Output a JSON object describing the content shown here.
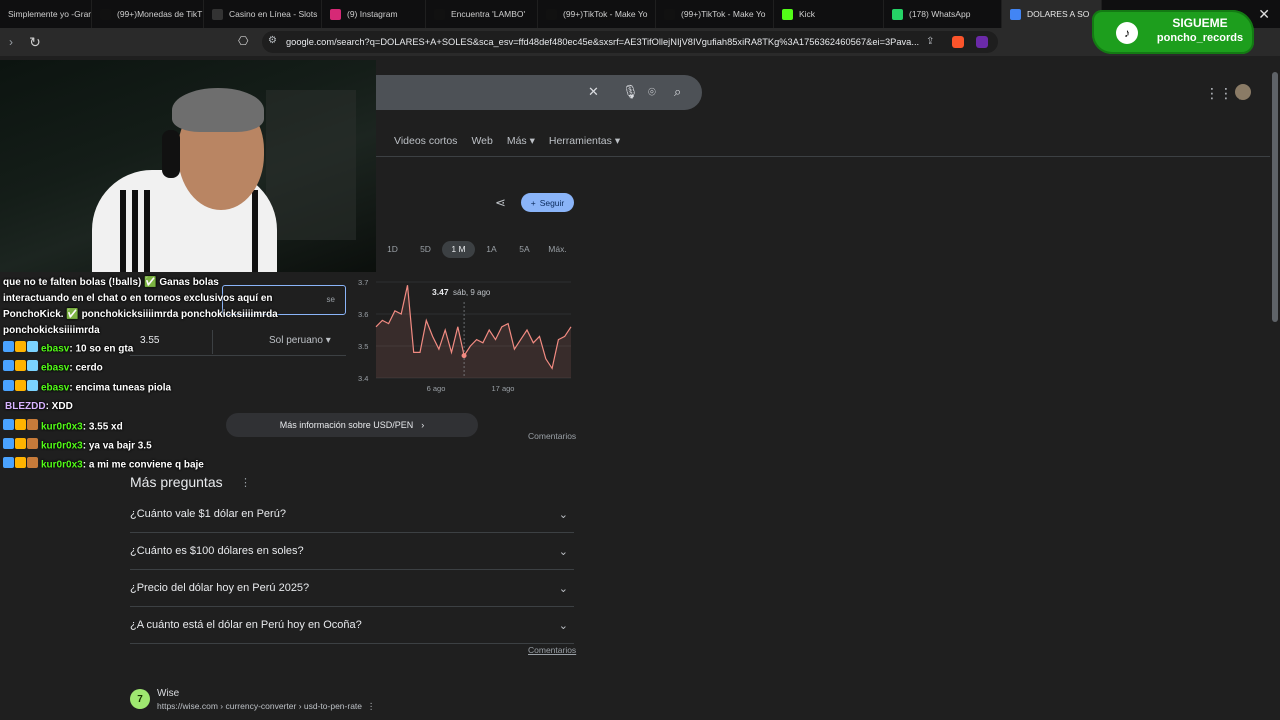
{
  "tabs": [
    {
      "label": "Simplemente yo -Gran",
      "color": "#444"
    },
    {
      "label": "(99+)Monedas de TikT",
      "color": "#111"
    },
    {
      "label": "Casino en Línea - Slots",
      "color": "#333"
    },
    {
      "label": "(9) Instagram",
      "color": "#d62976"
    },
    {
      "label": "Encuentra 'LAMBO'",
      "color": "#111"
    },
    {
      "label": "(99+)TikTok - Make Yo",
      "color": "#111"
    },
    {
      "label": "(99+)TikTok - Make Yo",
      "color": "#111"
    },
    {
      "label": "Kick",
      "color": "#53fc18"
    },
    {
      "label": "(178) WhatsApp",
      "color": "#25d366"
    },
    {
      "label": "DOLARES A SO",
      "color": "#4285f4"
    }
  ],
  "address": {
    "url": "google.com/search?q=DOLARES+A+SOLES&sca_esv=ffd48def480ec45e&sxsrf=AE3TifOllejNIjV8IVgufiah85xiRA8TKg%3A1756362460567&ei=3Pava..."
  },
  "google": {
    "tabs": [
      "Videos cortos",
      "Web",
      "Más ▾",
      "Herramientas ▾"
    ],
    "follow_label": "Seguir",
    "ranges": [
      "1D",
      "5D",
      "1 M",
      "1A",
      "5A",
      "Máx."
    ],
    "selected_range": "1 M",
    "more_info": "Más información sobre USD/PEN",
    "comments": "Comentarios",
    "converter": {
      "select_hint": "se",
      "value": "3.55",
      "currency": "Sol peruano"
    },
    "more_questions_title": "Más preguntas",
    "faqs": [
      "¿Cuánto vale $1 dólar en Perú?",
      "¿Cuánto es $100 dólares en soles?",
      "¿Precio del dólar hoy en Perú 2025?",
      "¿A cuánto está el dólar en Perú hoy en Ocoña?"
    ],
    "result": {
      "name": "Wise",
      "url": "https://wise.com › currency-converter › usd-to-pen-rate"
    }
  },
  "chart_data": {
    "type": "line",
    "title": "",
    "tooltip_value": "3.47",
    "tooltip_date": "sáb, 9 ago",
    "yticks": [
      "3.7",
      "3.6",
      "3.5",
      "3.4"
    ],
    "xticks": [
      "6 ago",
      "17 ago"
    ],
    "ylim": [
      3.4,
      3.7
    ],
    "values": [
      3.56,
      3.58,
      3.57,
      3.61,
      3.6,
      3.69,
      3.48,
      3.48,
      3.58,
      3.53,
      3.49,
      3.55,
      3.48,
      3.56,
      3.47,
      3.5,
      3.52,
      3.51,
      3.55,
      3.52,
      3.56,
      3.57,
      3.49,
      3.52,
      3.55,
      3.51,
      3.53,
      3.46,
      3.43,
      3.52,
      3.53,
      3.56
    ],
    "series_color": "#f28b82"
  },
  "chat": {
    "pinned": [
      "que no te falten bolas (!balls) ✅ Ganas bolas",
      "interactuando en el chat o en torneos exclusivos aquí en",
      "PonchoKick. ✅ ponchokicksiiiimrda ponchokicksiiiimrda",
      "ponchokicksiiiimrda"
    ],
    "messages": [
      {
        "user": "ebasv",
        "text": "10 so en gta",
        "badge_colors": [
          "#4aa3ff",
          "#ffb300",
          "#7bd3ff"
        ],
        "user_color": "green"
      },
      {
        "user": "ebasv",
        "text": "cerdo",
        "badge_colors": [
          "#4aa3ff",
          "#ffb300",
          "#7bd3ff"
        ],
        "user_color": "green"
      },
      {
        "user": "ebasv",
        "text": "encima tuneas piola",
        "badge_colors": [
          "#4aa3ff",
          "#ffb300",
          "#7bd3ff"
        ],
        "user_color": "green"
      },
      {
        "user": "BLEZDD",
        "text": "XDD",
        "badge_colors": [],
        "user_color": "purple"
      },
      {
        "user": "kur0r0x3",
        "text": "3.55 xd",
        "badge_colors": [
          "#4aa3ff",
          "#ffb300",
          "#c77b3a"
        ],
        "user_color": "green"
      },
      {
        "user": "kur0r0x3",
        "text": "ya va bajr 3.5",
        "badge_colors": [
          "#4aa3ff",
          "#ffb300",
          "#c77b3a"
        ],
        "user_color": "green"
      },
      {
        "user": "kur0r0x3",
        "text": "a mi me conviene q baje",
        "badge_colors": [
          "#4aa3ff",
          "#ffb300",
          "#c77b3a"
        ],
        "user_color": "green"
      }
    ]
  },
  "overlay": {
    "line1": "SIGUEME",
    "line2": "poncho_records"
  }
}
